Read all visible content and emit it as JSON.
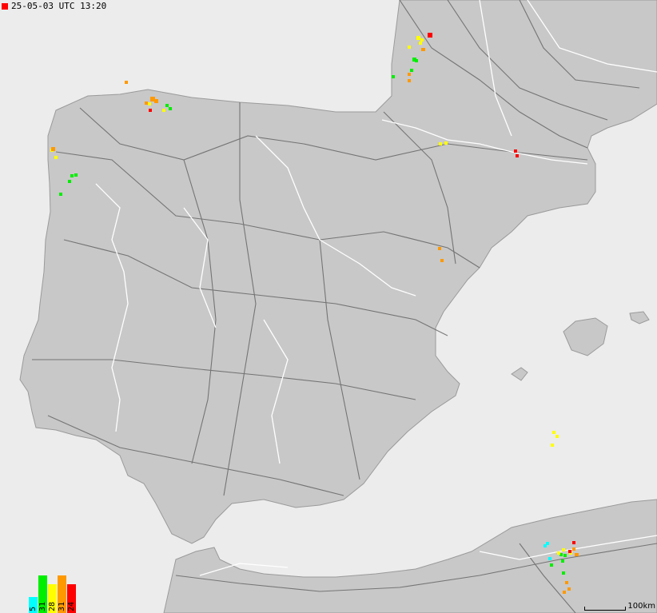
{
  "header": {
    "timestamp": "25-05-03 UTC 13:20",
    "marker_color": "#ff0000"
  },
  "legend": {
    "items": [
      {
        "label": "5",
        "color": "#00ffff"
      },
      {
        "label": "31",
        "color": "#00ee00"
      },
      {
        "label": "28",
        "color": "#ffff00"
      },
      {
        "label": "31",
        "color": "#ff9900"
      },
      {
        "label": "24",
        "color": "#ff0000"
      }
    ]
  },
  "scale": {
    "label": "100km"
  },
  "colors": {
    "sea": "#ececec",
    "land": "#c8c8c8",
    "roads": "#666666",
    "borders": "#ffffff"
  }
}
